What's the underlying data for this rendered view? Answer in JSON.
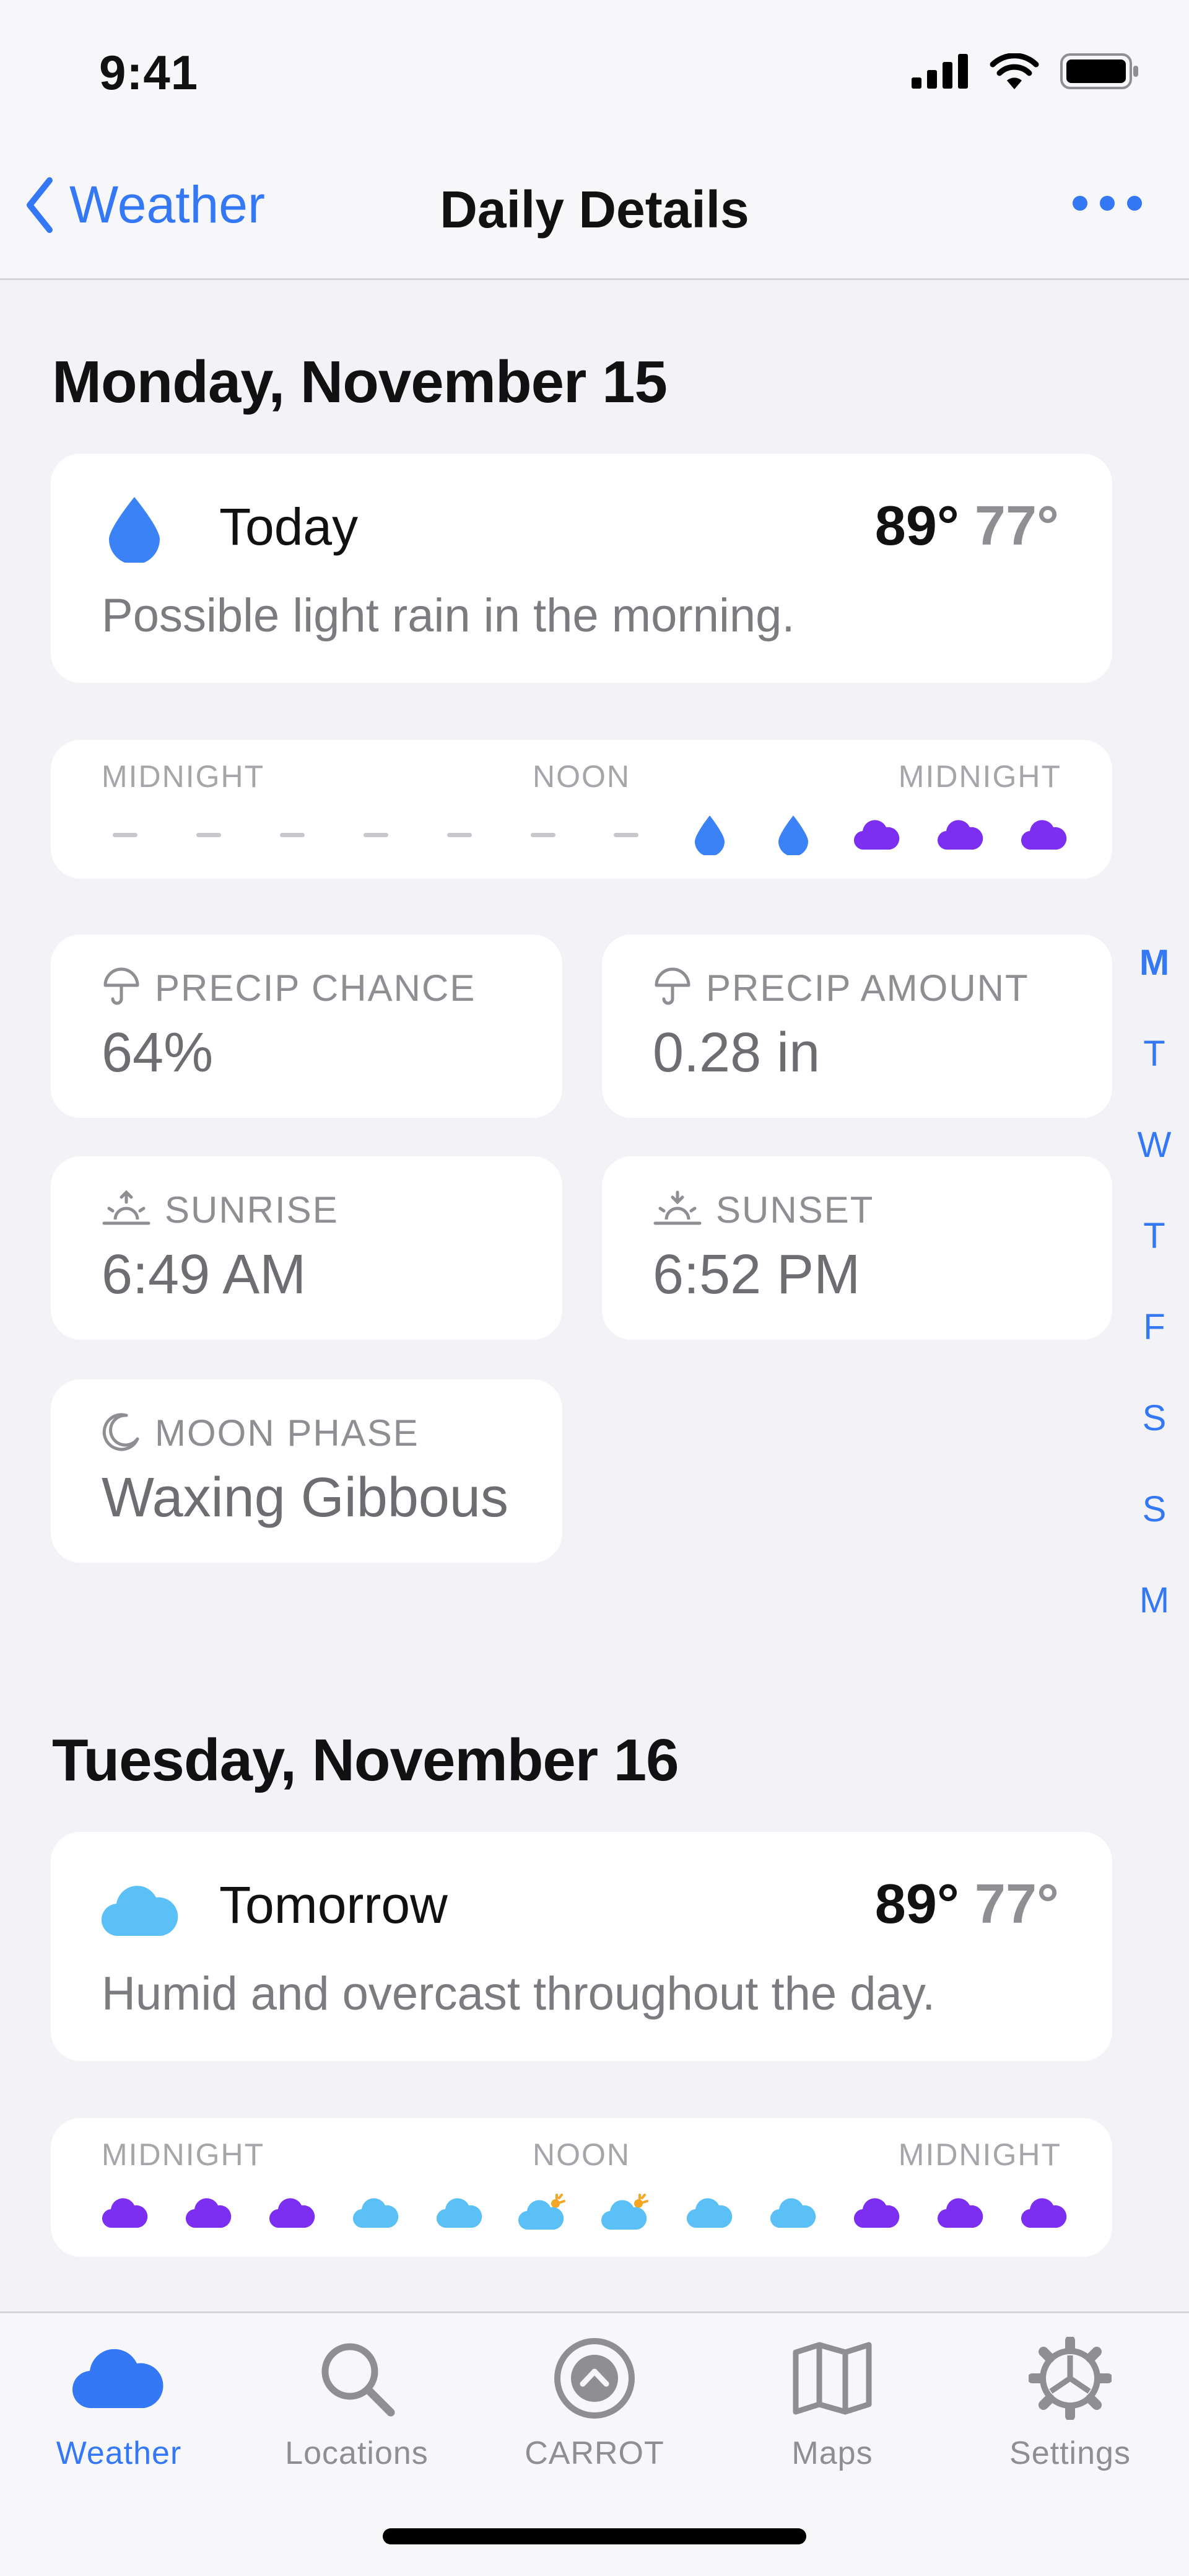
{
  "status_bar": {
    "time": "9:41"
  },
  "nav": {
    "back_label": "Weather",
    "title": "Daily Details"
  },
  "colors": {
    "accent": "#3478f6",
    "rain": "#3b82f6",
    "night_cloud": "#7c2ff0",
    "day_cloud": "#5bc0f5",
    "sun": "#f5a623"
  },
  "days": [
    {
      "heading": "Monday, November 15",
      "summary": {
        "icon": "raindrop-icon",
        "label": "Today",
        "high": "89°",
        "low": "77°",
        "description": "Possible light rain in the morning."
      },
      "hourly": {
        "labels": [
          "MIDNIGHT",
          "NOON",
          "MIDNIGHT"
        ],
        "icons": [
          "dash",
          "dash",
          "dash",
          "dash",
          "dash",
          "dash",
          "dash",
          "rain",
          "rain",
          "night-cloud",
          "night-cloud",
          "night-cloud"
        ]
      },
      "details": [
        {
          "icon": "umbrella-icon",
          "label": "PRECIP CHANCE",
          "value": "64%"
        },
        {
          "icon": "umbrella-icon",
          "label": "PRECIP AMOUNT",
          "value": "0.28 in"
        },
        {
          "icon": "sunrise-icon",
          "label": "SUNRISE",
          "value": "6:49 AM"
        },
        {
          "icon": "sunset-icon",
          "label": "SUNSET",
          "value": "6:52 PM"
        },
        {
          "icon": "moon-icon",
          "label": "MOON PHASE",
          "value": "Waxing Gibbous"
        }
      ]
    },
    {
      "heading": "Tuesday, November 16",
      "summary": {
        "icon": "cloud-icon",
        "label": "Tomorrow",
        "high": "89°",
        "low": "77°",
        "description": "Humid and overcast throughout the day."
      },
      "hourly": {
        "labels": [
          "MIDNIGHT",
          "NOON",
          "MIDNIGHT"
        ],
        "icons": [
          "night-cloud",
          "night-cloud",
          "night-cloud",
          "day-cloud",
          "day-cloud",
          "day-cloud-sun",
          "day-cloud-sun",
          "day-cloud",
          "day-cloud",
          "night-cloud",
          "night-cloud",
          "night-cloud"
        ]
      }
    }
  ],
  "day_index": [
    "M",
    "T",
    "W",
    "T",
    "F",
    "S",
    "S",
    "M"
  ],
  "tabs": [
    {
      "label": "Weather",
      "icon": "cloud-icon"
    },
    {
      "label": "Locations",
      "icon": "search-icon"
    },
    {
      "label": "CARROT",
      "icon": "carrot-logo-icon"
    },
    {
      "label": "Maps",
      "icon": "map-icon"
    },
    {
      "label": "Settings",
      "icon": "gear-icon"
    }
  ]
}
